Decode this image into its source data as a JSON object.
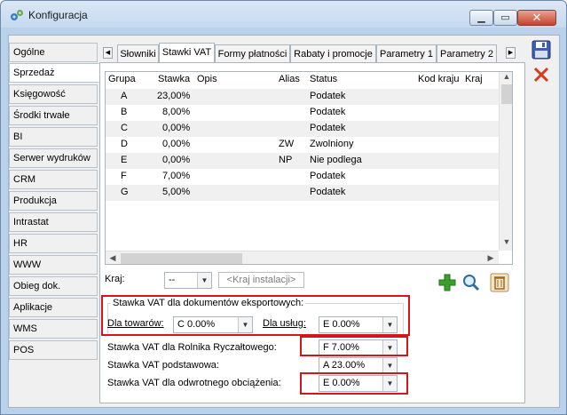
{
  "window": {
    "title": "Konfiguracja"
  },
  "nav": {
    "items": [
      "Ogólne",
      "Sprzedaż",
      "Księgowość",
      "Środki trwałe",
      "BI",
      "Serwer wydruków",
      "CRM",
      "Produkcja",
      "Intrastat",
      "HR",
      "WWW",
      "Obieg dok.",
      "Aplikacje",
      "WMS",
      "POS"
    ],
    "active": "Sprzedaż"
  },
  "tabs": {
    "items": [
      "Słowniki",
      "Stawki VAT",
      "Formy płatności",
      "Rabaty i promocje",
      "Parametry 1",
      "Parametry 2"
    ],
    "active": "Stawki VAT"
  },
  "grid": {
    "columns": [
      "Grupa",
      "Stawka",
      "Opis",
      "Alias",
      "Status",
      "Kod kraju",
      "Kraj"
    ],
    "rows": [
      [
        "A",
        "23,00%",
        "",
        "",
        "Podatek",
        "",
        ""
      ],
      [
        "B",
        "8,00%",
        "",
        "",
        "Podatek",
        "",
        ""
      ],
      [
        "C",
        "0,00%",
        "",
        "",
        "Podatek",
        "",
        ""
      ],
      [
        "D",
        "0,00%",
        "",
        "ZW",
        "Zwolniony",
        "",
        ""
      ],
      [
        "E",
        "0,00%",
        "",
        "NP",
        "Nie podlega",
        "",
        ""
      ],
      [
        "F",
        "7,00%",
        "",
        "",
        "Podatek",
        "",
        ""
      ],
      [
        "G",
        "5,00%",
        "",
        "",
        "Podatek",
        "",
        ""
      ]
    ]
  },
  "kraj": {
    "label": "Kraj:",
    "value": "--",
    "link": "<Kraj instalacji>"
  },
  "export": {
    "title": "Stawka VAT dla dokumentów eksportowych:",
    "goods_label": "Dla towarów:",
    "goods_value": "C 0.00%",
    "services_label": "Dla usług:",
    "services_value": "E 0.00%"
  },
  "rolnik": {
    "label": "Stawka VAT dla Rolnika Ryczałtowego:",
    "value": "F 7.00%"
  },
  "basic": {
    "label": "Stawka VAT podstawowa:",
    "value": "A 23.00%"
  },
  "reverse": {
    "label": "Stawka VAT dla odwrotnego obciążenia:",
    "value": "E 0.00%"
  },
  "colors": {
    "highlight": "#d5141b",
    "add": "#3aa02c",
    "delete": "#d63a1f"
  }
}
